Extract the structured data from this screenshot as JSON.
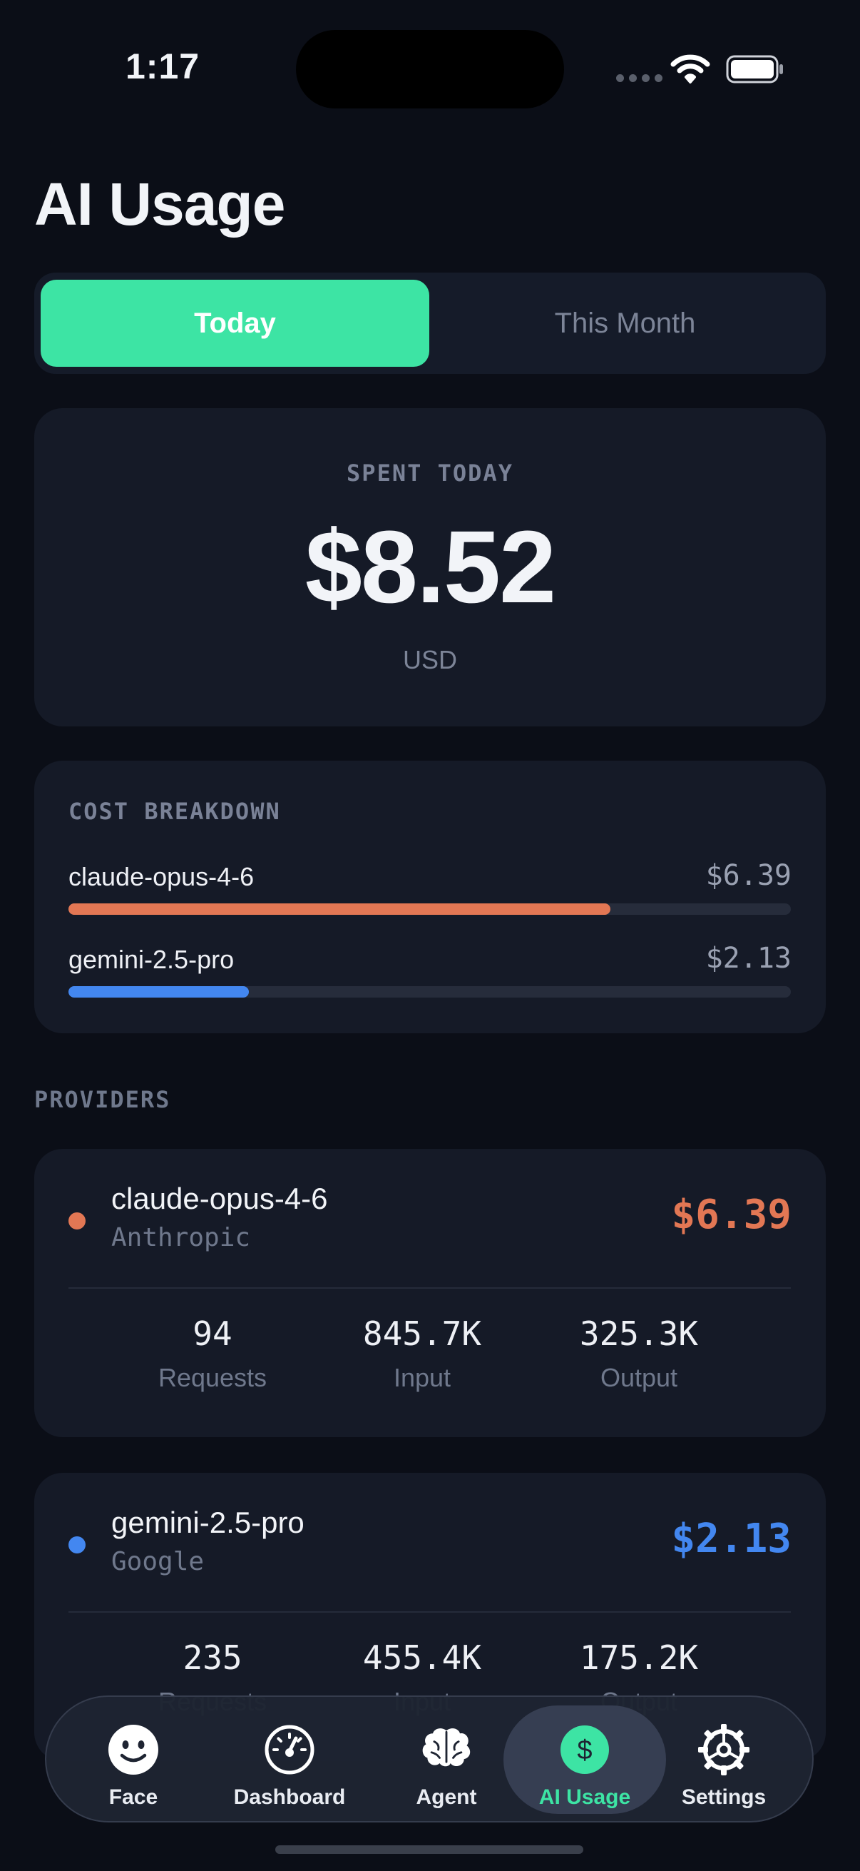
{
  "status_bar": {
    "time": "1:17"
  },
  "page": {
    "title": "AI Usage"
  },
  "segment": {
    "today": "Today",
    "this_month": "This Month"
  },
  "spent": {
    "label": "SPENT TODAY",
    "value": "$8.52",
    "currency": "USD"
  },
  "breakdown": {
    "title": "COST BREAKDOWN",
    "items": [
      {
        "name": "claude-opus-4-6",
        "cost": "$6.39",
        "share": 0.75,
        "color": "#e27754"
      },
      {
        "name": "gemini-2.5-pro",
        "cost": "$2.13",
        "share": 0.25,
        "color": "#4387f0"
      }
    ]
  },
  "providers": {
    "label": "PROVIDERS",
    "items": [
      {
        "name": "claude-opus-4-6",
        "vendor": "Anthropic",
        "cost": "$6.39",
        "color": "#e27754",
        "stats": [
          {
            "value": "94",
            "label": "Requests"
          },
          {
            "value": "845.7K",
            "label": "Input"
          },
          {
            "value": "325.3K",
            "label": "Output"
          }
        ]
      },
      {
        "name": "gemini-2.5-pro",
        "vendor": "Google",
        "cost": "$2.13",
        "color": "#4387f0",
        "stats": [
          {
            "value": "235",
            "label": "Requests"
          },
          {
            "value": "455.4K",
            "label": "Input"
          },
          {
            "value": "175.2K",
            "label": "Output"
          }
        ]
      }
    ]
  },
  "tabbar": {
    "tabs": [
      {
        "label": "Face",
        "icon": "smiley-face-icon"
      },
      {
        "label": "Dashboard",
        "icon": "gauge-icon"
      },
      {
        "label": "Agent",
        "icon": "brain-icon"
      },
      {
        "label": "AI Usage",
        "icon": "dollar-circle-icon",
        "active": true
      },
      {
        "label": "Settings",
        "icon": "gear-icon"
      }
    ]
  },
  "colors": {
    "accent": "#3de4a4",
    "background": "#0b0e17",
    "card": "#151a27"
  }
}
